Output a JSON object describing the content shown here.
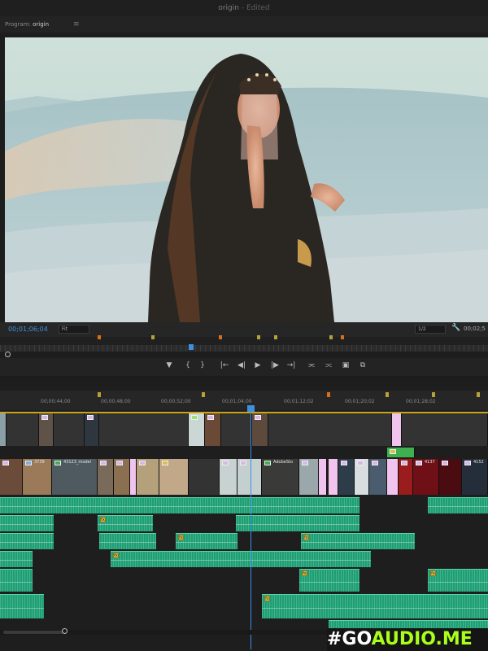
{
  "window": {
    "title": "origin",
    "status": "- Edited"
  },
  "program_panel": {
    "label": "Program:",
    "sequence": "origin",
    "menu_icon": "hamburger-icon"
  },
  "viewer": {
    "timecode": "00;01;06;04",
    "fit": "Fit",
    "resolution": "1/2",
    "duration": "00;02;5",
    "settings_icon": "wrench-icon"
  },
  "transport": {
    "buttons": [
      {
        "name": "add-marker-icon",
        "glyph": "▼"
      },
      {
        "name": "mark-in-icon",
        "glyph": "{"
      },
      {
        "name": "mark-out-icon",
        "glyph": "}"
      },
      {
        "name": "go-to-in-icon",
        "glyph": "|←"
      },
      {
        "name": "step-back-icon",
        "glyph": "◀|"
      },
      {
        "name": "play-icon",
        "glyph": "▶"
      },
      {
        "name": "step-forward-icon",
        "glyph": "|▶"
      },
      {
        "name": "go-to-out-icon",
        "glyph": "→|"
      },
      {
        "name": "lift-icon",
        "glyph": "⫘"
      },
      {
        "name": "extract-icon",
        "glyph": "⫗"
      },
      {
        "name": "export-frame-icon",
        "glyph": "▣"
      },
      {
        "name": "comparison-view-icon",
        "glyph": "⧉"
      }
    ]
  },
  "timeline": {
    "ruler_labels": [
      "00;00;44;00",
      "00;00;48;00",
      "00;00;52;00",
      "00;01;04;00",
      "00;01;12;02",
      "00;01;20;02",
      "00;01;28;02"
    ],
    "clip_labels": [
      "3739",
      "43123_model",
      "AdobeSto",
      "4137",
      "4152"
    ]
  },
  "colors": {
    "accent": "#3f8fe0",
    "audio": "#1d9f74",
    "marker": "#d8701a",
    "work_area": "#c9a41b"
  },
  "watermark": {
    "part1": "#GO",
    "part2": "AUDIO.ME"
  }
}
